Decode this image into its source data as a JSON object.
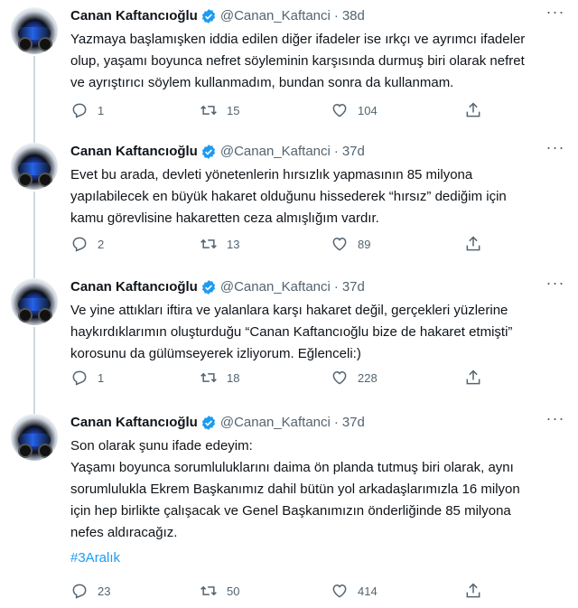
{
  "tweets": [
    {
      "name": "Canan Kaftancıoğlu",
      "handle": "@Canan_Kaftanci",
      "separator": "·",
      "time": "38d",
      "lines": [
        "Yazmaya başlamışken iddia edilen diğer ifadeler ise ırkçı ve ayrımcı ifadeler",
        "olup, yaşamı boyunca nefret söyleminin karşısında durmuş biri olarak nefret",
        "ve ayrıştırıcı söylem kullanmadım, bundan sonra da kullanmam."
      ],
      "replies": "1",
      "retweets": "15",
      "likes": "104"
    },
    {
      "name": "Canan Kaftancıoğlu",
      "handle": "@Canan_Kaftanci",
      "separator": "·",
      "time": "37d",
      "lines": [
        "Evet bu arada, devleti yönetenlerin hırsızlık yapmasının 85 milyona",
        "yapılabilecek en büyük hakaret olduğunu hissederek “hırsız” dediğim için",
        "kamu görevlisine hakaretten ceza almışlığım vardır."
      ],
      "replies": "2",
      "retweets": "13",
      "likes": "89"
    },
    {
      "name": "Canan Kaftancıoğlu",
      "handle": "@Canan_Kaftanci",
      "separator": "·",
      "time": "37d",
      "lines": [
        "Ve yine attıkları iftira ve yalanlara karşı hakaret değil, gerçekleri yüzlerine",
        "haykırdıklarımın oluşturduğu “Canan Kaftancıoğlu bize de hakaret etmişti”",
        "korosunu da gülümseyerek izliyorum. Eğlenceli:)"
      ],
      "replies": "1",
      "retweets": "18",
      "likes": "228"
    },
    {
      "name": "Canan Kaftancıoğlu",
      "handle": "@Canan_Kaftanci",
      "separator": "·",
      "time": "37d",
      "lines": [
        "Son olarak şunu ifade edeyim:",
        "Yaşamı boyunca sorumluluklarını daima ön planda tutmuş biri olarak, aynı",
        "sorumlulukla Ekrem Başkanımız dahil bütün yol arkadaşlarımızla 16 milyon",
        "için hep birlikte çalışacak ve Genel Başkanımızın önderliğinde 85 milyona",
        "nefes aldıracağız."
      ],
      "hashtag": "#3Aralık",
      "replies": "23",
      "retweets": "50",
      "likes": "414"
    }
  ],
  "icons": {
    "verified": "verified-badge-icon",
    "more": "more-icon",
    "reply": "reply-icon",
    "retweet": "retweet-icon",
    "like": "heart-icon",
    "share": "share-icon"
  },
  "colors": {
    "verified": "#1d9bf0",
    "hashtag": "#1d9bf0",
    "muted": "#536471",
    "text": "#0f1419",
    "thread_line": "#cfd9de"
  }
}
